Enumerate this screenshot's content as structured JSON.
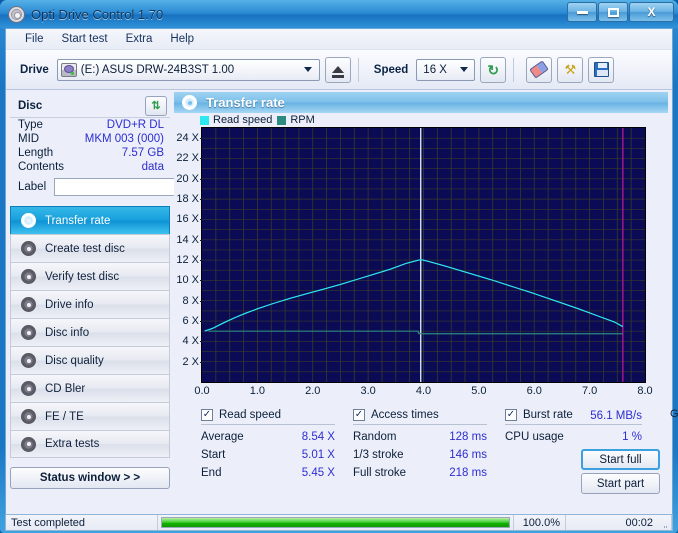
{
  "window": {
    "title": "Opti Drive Control 1.70",
    "icon": "disc-icon",
    "minimize": "minimize-icon",
    "maximize": "maximize-icon",
    "close": "X"
  },
  "menu": {
    "items": [
      "File",
      "Start test",
      "Extra",
      "Help"
    ]
  },
  "toolbar": {
    "drive_label": "Drive",
    "drive_value": "(E:)   ASUS DRW-24B3ST 1.00",
    "eject_icon": "eject-icon",
    "speed_label": "Speed",
    "speed_value": "16 X",
    "refresh_icon": "↻",
    "erase_icon": "eraser-icon",
    "tools_icon": "⚒",
    "save_icon": "save-icon"
  },
  "disc_panel": {
    "title": "Disc",
    "refresh_icon": "⇅",
    "rows": [
      {
        "key": "Type",
        "value": "DVD+R DL"
      },
      {
        "key": "MID",
        "value": "MKM 003 (000)"
      },
      {
        "key": "Length",
        "value": "7.57 GB"
      },
      {
        "key": "Contents",
        "value": "data"
      }
    ],
    "label_key": "Label",
    "label_value": "",
    "label_placeholder": "",
    "disc_button_icon": "cd-icon"
  },
  "nav": {
    "items": [
      {
        "label": "Transfer rate",
        "active": true
      },
      {
        "label": "Create test disc",
        "active": false
      },
      {
        "label": "Verify test disc",
        "active": false
      },
      {
        "label": "Drive info",
        "active": false
      },
      {
        "label": "Disc info",
        "active": false
      },
      {
        "label": "Disc quality",
        "active": false
      },
      {
        "label": "CD Bler",
        "active": false
      },
      {
        "label": "FE / TE",
        "active": false
      },
      {
        "label": "Extra tests",
        "active": false
      }
    ],
    "status_window": "Status window > >"
  },
  "chart": {
    "header_title": "Transfer rate",
    "header_icon": "disc-icon"
  },
  "chart_data": {
    "type": "line",
    "title": "Transfer rate",
    "xlabel": "GB",
    "ylabel": "X",
    "xlim": [
      0.0,
      8.0
    ],
    "ylim": [
      0,
      25
    ],
    "grid": true,
    "legend_position": "top-left",
    "x_unit": "GB",
    "xticks": [
      "0.0",
      "1.0",
      "2.0",
      "3.0",
      "4.0",
      "5.0",
      "6.0",
      "7.0",
      "8.0"
    ],
    "yticks": [
      "2 X",
      "4 X",
      "6 X",
      "8 X",
      "10 X",
      "12 X",
      "14 X",
      "16 X",
      "18 X",
      "20 X",
      "22 X",
      "24 X"
    ],
    "legend": [
      {
        "name": "Read speed",
        "color": "#2ee8f0"
      },
      {
        "name": "RPM",
        "color": "#2d8a7e"
      }
    ],
    "markers": [
      {
        "name": "layer-break",
        "x": 3.95,
        "color": "#d8f0ff"
      },
      {
        "name": "disc-end",
        "x": 7.6,
        "color": "#b4188c"
      }
    ],
    "series": [
      {
        "name": "Read speed",
        "color": "#2ee8f0",
        "points": [
          [
            0.05,
            5.01
          ],
          [
            0.2,
            5.3
          ],
          [
            0.4,
            5.85
          ],
          [
            0.6,
            6.35
          ],
          [
            0.8,
            6.8
          ],
          [
            1.0,
            7.2
          ],
          [
            1.3,
            7.75
          ],
          [
            1.6,
            8.25
          ],
          [
            1.9,
            8.7
          ],
          [
            2.2,
            9.15
          ],
          [
            2.5,
            9.6
          ],
          [
            2.8,
            10.1
          ],
          [
            3.1,
            10.6
          ],
          [
            3.4,
            11.1
          ],
          [
            3.7,
            11.7
          ],
          [
            3.95,
            12.05
          ],
          [
            4.1,
            11.85
          ],
          [
            4.4,
            11.4
          ],
          [
            4.8,
            10.75
          ],
          [
            5.2,
            10.1
          ],
          [
            5.6,
            9.4
          ],
          [
            6.0,
            8.7
          ],
          [
            6.4,
            7.95
          ],
          [
            6.8,
            7.2
          ],
          [
            7.2,
            6.4
          ],
          [
            7.45,
            5.9
          ],
          [
            7.6,
            5.45
          ]
        ]
      },
      {
        "name": "RPM",
        "color": "#2d8a7e",
        "points": [
          [
            0.12,
            5.0
          ],
          [
            3.9,
            5.0
          ],
          [
            3.92,
            4.75
          ],
          [
            4.5,
            4.75
          ],
          [
            7.6,
            4.75
          ]
        ]
      }
    ]
  },
  "stats": {
    "read_speed": {
      "checkbox_label": "Read speed",
      "checked": true,
      "rows": [
        {
          "key": "Average",
          "value": "8.54 X"
        },
        {
          "key": "Start",
          "value": "5.01 X"
        },
        {
          "key": "End",
          "value": "5.45 X"
        }
      ]
    },
    "access_times": {
      "checkbox_label": "Access times",
      "checked": true,
      "rows": [
        {
          "key": "Random",
          "value": "128 ms"
        },
        {
          "key": "1/3 stroke",
          "value": "146 ms"
        },
        {
          "key": "Full stroke",
          "value": "218 ms"
        }
      ]
    },
    "burst": {
      "checkbox_label": "Burst rate",
      "checked": true,
      "burst_value": "56.1 MB/s",
      "cpu_key": "CPU usage",
      "cpu_value": "1 %",
      "start_full": "Start full",
      "start_part": "Start part"
    }
  },
  "statusbar": {
    "message": "Test completed",
    "percent": "100.0%",
    "progress": 100,
    "time": "00:02"
  }
}
